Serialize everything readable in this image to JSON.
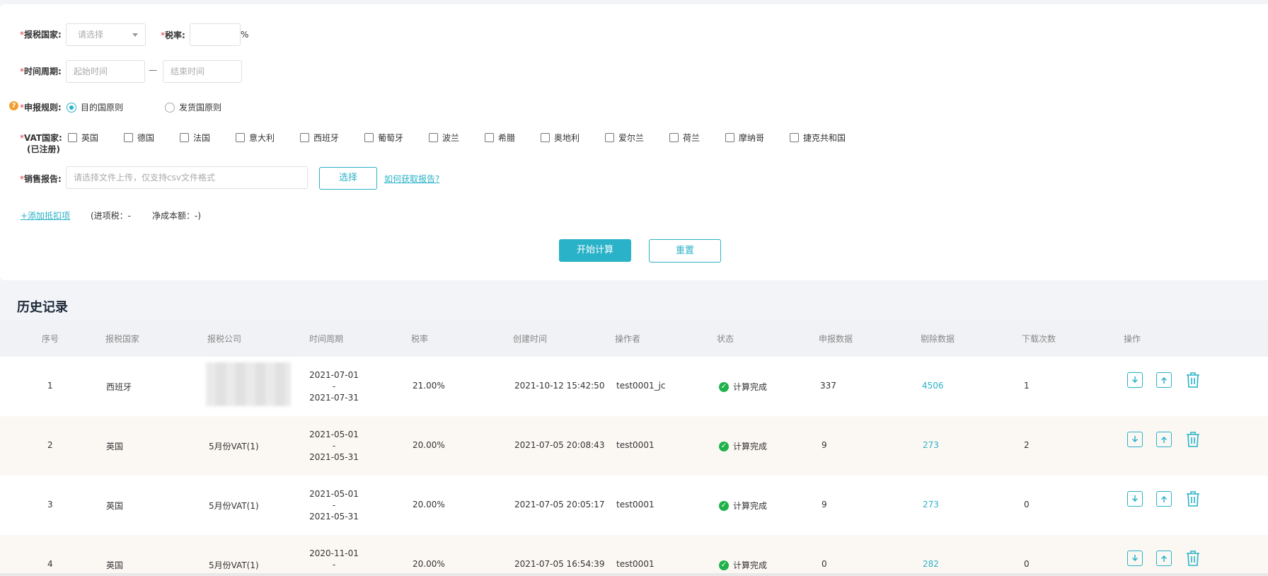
{
  "form": {
    "country_label": "报税国家:",
    "country_placeholder": "请选择",
    "tax_rate_label": "税率:",
    "tax_rate_value": "",
    "percent": "%",
    "period_label": "时间周期:",
    "start_placeholder": "起始时间",
    "separator": "—",
    "end_placeholder": "结束时间",
    "rule_label": "申报规则:",
    "rule_options": [
      "目的国原则",
      "发货国原则"
    ],
    "vat_label_line1": "VAT国家:",
    "vat_label_line2": "(已注册)",
    "vat_countries": [
      "英国",
      "德国",
      "法国",
      "意大利",
      "西班牙",
      "葡萄牙",
      "波兰",
      "希腊",
      "奥地利",
      "爱尔兰",
      "荷兰",
      "摩纳哥",
      "捷克共和国"
    ],
    "report_label": "销售报告:",
    "report_placeholder": "请选择文件上传，仅支持csv文件格式",
    "choose_button": "选择",
    "how_link": "如何获取报告?",
    "add_deduction_link": "+添加抵扣项",
    "input_tax_text": "(进项税：-",
    "net_cost_text": "净成本额：-)",
    "start_button": "开始计算",
    "reset_button": "重置"
  },
  "history": {
    "title": "历史记录",
    "columns": [
      "序号",
      "报税国家",
      "报税公司",
      "时间周期",
      "税率",
      "创建时间",
      "操作者",
      "状态",
      "申报数据",
      "剔除数据",
      "下载次数",
      "操作"
    ],
    "rows": [
      {
        "no": "1",
        "country": "西班牙",
        "company": "",
        "period_start": "2021-07-01",
        "dash": "-",
        "period_end": "2021-07-31",
        "rate": "21.00%",
        "created": "2021-10-12 15:42:50",
        "operator": "test0001_jc",
        "status": "计算完成",
        "declared": "337",
        "excluded": "4506",
        "downloads": "1"
      },
      {
        "no": "2",
        "country": "英国",
        "company": "5月份VAT(1)",
        "period_start": "2021-05-01",
        "dash": "-",
        "period_end": "2021-05-31",
        "rate": "20.00%",
        "created": "2021-07-05 20:08:43",
        "operator": "test0001",
        "status": "计算完成",
        "declared": "9",
        "excluded": "273",
        "downloads": "2"
      },
      {
        "no": "3",
        "country": "英国",
        "company": "5月份VAT(1)",
        "period_start": "2021-05-01",
        "dash": "-",
        "period_end": "2021-05-31",
        "rate": "20.00%",
        "created": "2021-07-05 20:05:17",
        "operator": "test0001",
        "status": "计算完成",
        "declared": "9",
        "excluded": "273",
        "downloads": "0"
      },
      {
        "no": "4",
        "country": "英国",
        "company": "5月份VAT(1)",
        "period_start": "2020-11-01",
        "dash": "-",
        "period_end": "",
        "rate": "20.00%",
        "created": "2021-07-05 16:54:39",
        "operator": "test0001",
        "status": "计算完成",
        "declared": "0",
        "excluded": "282",
        "downloads": "0"
      }
    ]
  },
  "colors": {
    "accent": "#2ab2c8",
    "required": "#e4393c",
    "success": "#1fb14a",
    "help": "#f0a030"
  },
  "icons": [
    "caret-down-icon",
    "help-icon",
    "check-circle-icon",
    "download-icon",
    "upload-icon",
    "trash-icon"
  ]
}
